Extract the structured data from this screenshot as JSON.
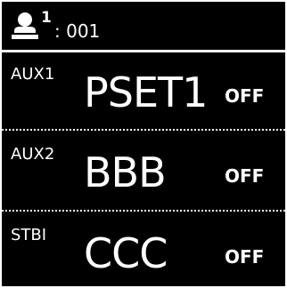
{
  "header": {
    "user_icon": "person-icon",
    "user_index": "1",
    "user_id": ": 001"
  },
  "rows": [
    {
      "label": "AUX1",
      "name": "PSET1",
      "status": "OFF"
    },
    {
      "label": "AUX2",
      "name": "BBB",
      "status": "OFF"
    },
    {
      "label": "STBI",
      "name": "CCC",
      "status": "OFF"
    }
  ],
  "colors": {
    "background": "#000000",
    "foreground": "#ffffff"
  }
}
